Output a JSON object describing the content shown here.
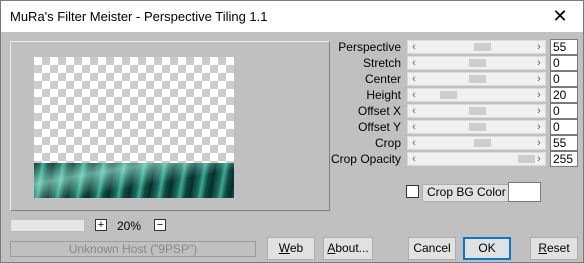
{
  "window": {
    "title": "MuRa's Filter Meister - Perspective Tiling 1.1",
    "close_glyph": "✕"
  },
  "params": [
    {
      "label": "Perspective",
      "value": "55",
      "level": 0.55
    },
    {
      "label": "Stretch",
      "value": "0",
      "level": 0.5
    },
    {
      "label": "Center",
      "value": "0",
      "level": 0.5
    },
    {
      "label": "Height",
      "value": "20",
      "level": 0.2
    },
    {
      "label": "Offset X",
      "value": "0",
      "level": 0.5
    },
    {
      "label": "Offset Y",
      "value": "0",
      "level": 0.5
    },
    {
      "label": "Crop",
      "value": "55",
      "level": 0.55
    },
    {
      "label": "Crop Opacity",
      "value": "255",
      "level": 1.0
    }
  ],
  "crop_bg": {
    "label": "Crop BG Color",
    "checked": false,
    "color": "#ffffff"
  },
  "zoom": {
    "plus": "+",
    "minus": "−",
    "value": "20%"
  },
  "host": {
    "text": "Unknown Host (\"9PSP\")"
  },
  "buttons": {
    "web_pre": "",
    "web_u": "W",
    "web_post": "eb",
    "about_pre": "",
    "about_u": "A",
    "about_post": "bout...",
    "cancel": "Cancel",
    "ok": "OK",
    "reset_pre": "",
    "reset_u": "R",
    "reset_post": "eset"
  },
  "icons": {
    "left_arrow": "‹",
    "right_arrow": "›"
  }
}
